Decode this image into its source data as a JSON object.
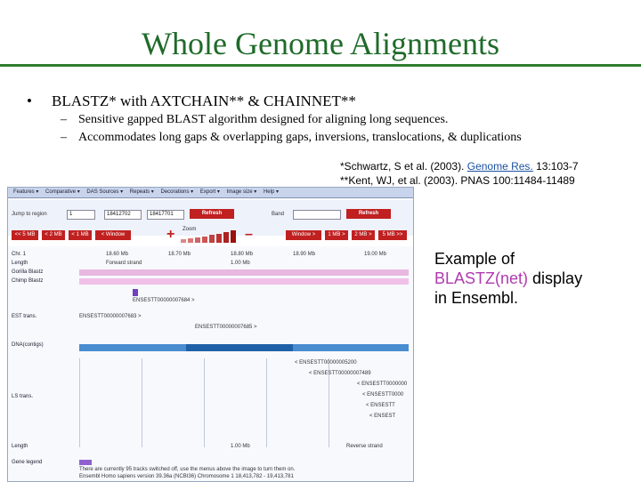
{
  "slide": {
    "title": "Whole Genome Alignments",
    "bullet_symbol": "•",
    "bullet": "BLASTZ* with AXTCHAIN** & CHAINNET**",
    "sub_dash": "–",
    "sub_items": [
      "Sensitive gapped BLAST algorithm designed for aligning long sequences.",
      "Accommodates long gaps & overlapping gaps, inversions, translocations, & duplications"
    ],
    "citations": {
      "line1_prefix": "*Schwartz, S et al. (2003). ",
      "line1_link": "Genome Res.",
      "line1_suffix": " 13:103-7",
      "line2": "**Kent, WJ, et al. (2003). PNAS 100:11484-11489"
    },
    "callout": {
      "line1": "Example of",
      "line2_highlight": "BLASTZ(net)",
      "line2_rest": " display",
      "line3": "in Ensembl."
    },
    "colors": {
      "title": "#1f6b2a",
      "rule": "#2e7d2e",
      "highlight": "#b03ab0",
      "link": "#1a4fa0"
    }
  },
  "ensembl": {
    "menu": [
      "Features ▾",
      "Comparative ▾",
      "DAS Sources ▾",
      "Repeats ▾",
      "Decorations ▾",
      "Export ▾",
      "Image size ▾",
      "Help ▾"
    ],
    "jump_label": "Jump to region",
    "chr_value": "1",
    "start_value": "18412702",
    "end_value": "18417701",
    "refresh_label": "Refresh",
    "bp_label": "Band",
    "nav_buttons": [
      "<< 5 MB",
      "< 2 MB",
      "< 1 MB",
      "< Window",
      "Window >",
      "1 MB >",
      "2 MB >",
      "5 MB >>"
    ],
    "zoom_label": "Zoom",
    "tracks": [
      "Chr. 1",
      "Length",
      "Gorilla Blastz",
      "Chimp Blastz",
      "EST trans.",
      "DNA(contigs)",
      "LS trans.",
      "Length",
      "Gene legend"
    ],
    "scale_ticks": [
      "18.60 Mb",
      "18.70 Mb",
      "18.80 Mb",
      "18.90 Mb",
      "19.00 Mb"
    ],
    "strand_labels": [
      "Forward strand",
      "1.00 Mb",
      "Reverse strand"
    ],
    "feature_ids": [
      "ENSESTT00000007684 >",
      "ENSESTT00000007683 >",
      "ENSESTT00000007685 >",
      "< ENSESTT00000005200",
      "< ENSESTT00000007489",
      "< ENSESTT0000000",
      "< ENSESTT0000",
      "< ENSESTT",
      "< ENSEST"
    ],
    "footer_lines": [
      "There are currently 95 tracks switched off, use the menus above the image to turn them on.",
      "Ensembl Homo sapiens version 39.36a (NCBI36) Chromosome 1 18,413,782 - 19,413,781"
    ]
  }
}
